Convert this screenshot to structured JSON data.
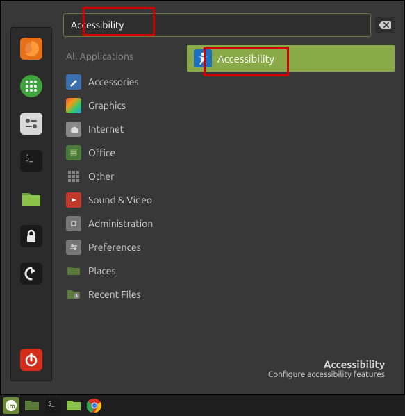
{
  "search": {
    "value": "Accessibility"
  },
  "categories": {
    "header": "All Applications",
    "items": [
      {
        "label": "Accessories"
      },
      {
        "label": "Graphics"
      },
      {
        "label": "Internet"
      },
      {
        "label": "Office"
      },
      {
        "label": "Other"
      },
      {
        "label": "Sound & Video"
      },
      {
        "label": "Administration"
      },
      {
        "label": "Preferences"
      },
      {
        "label": "Places"
      },
      {
        "label": "Recent Files"
      }
    ]
  },
  "result": {
    "label": "Accessibility"
  },
  "footer": {
    "title": "Accessibility",
    "desc": "Configure accessibility features"
  },
  "colors": {
    "selection": "#8aaa4a",
    "accent_blue": "#1a6fbf",
    "power_red": "#d62c1a"
  }
}
